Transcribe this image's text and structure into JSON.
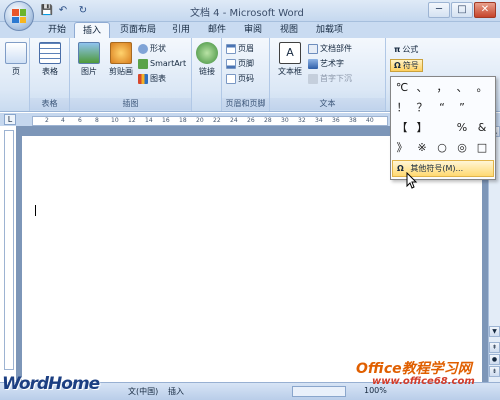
{
  "window": {
    "title": "文档 4 - Microsoft Word",
    "controls": {
      "minimize": "─",
      "maximize": "□",
      "close": "✕"
    }
  },
  "qat": {
    "save": "💾",
    "undo": "↶",
    "redo": "↻"
  },
  "tabs": [
    {
      "label": "开始"
    },
    {
      "label": "插入",
      "active": true
    },
    {
      "label": "页面布局"
    },
    {
      "label": "引用"
    },
    {
      "label": "邮件"
    },
    {
      "label": "审阅"
    },
    {
      "label": "视图"
    },
    {
      "label": "加载项"
    }
  ],
  "ribbon": {
    "pages": {
      "label": "页"
    },
    "table": {
      "button": "表格",
      "group": "表格"
    },
    "illustrations": {
      "picture": "图片",
      "clipart": "剪贴画",
      "shapes": "形状",
      "smartart": "SmartArt",
      "chart": "图表",
      "group": "插图"
    },
    "links": {
      "button": "链接"
    },
    "header_footer": {
      "header": "页眉",
      "footer": "页脚",
      "page_number": "页码",
      "group": "页眉和页脚"
    },
    "text": {
      "textbox": "文本框",
      "quickparts": "文档部件",
      "wordart": "艺术字",
      "dropcap": "首字下沉",
      "group": "文本"
    },
    "symbols": {
      "equation": "公式",
      "symbol": "符号",
      "pi": "π",
      "omega": "Ω"
    }
  },
  "symbol_menu": {
    "symbols": [
      "℃",
      "、",
      "，",
      "、",
      "。",
      "！",
      "？",
      "“",
      "”",
      "【",
      "】",
      "%",
      "&",
      "》",
      "※",
      "○",
      "◎",
      "□"
    ],
    "more": "其他符号(M)..."
  },
  "ruler": {
    "corner": "L",
    "ticks": [
      "2",
      "4",
      "6",
      "8",
      "10",
      "12",
      "14",
      "16",
      "18",
      "20",
      "22",
      "24",
      "26",
      "28",
      "30",
      "32",
      "34",
      "36",
      "38",
      "40"
    ]
  },
  "statusbar": {
    "language": "文(中国)",
    "mode": "插入",
    "zoom": "100%"
  },
  "watermarks": {
    "wordhome": "WordHome",
    "site": "Office教程学习网",
    "url": "www.office68.com"
  }
}
